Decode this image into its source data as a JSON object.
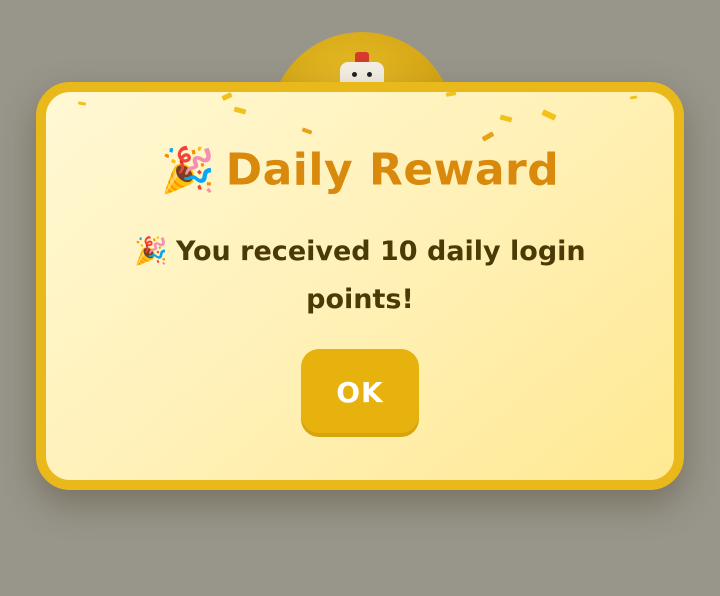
{
  "dialog": {
    "title_icon": "🎉",
    "title": "Daily Reward",
    "message_icon": "🎉",
    "message": "You received 10 daily login points!",
    "ok_label": "OK"
  },
  "background": {
    "mascot": "chicken-icon"
  },
  "colors": {
    "accent": "#e9b81a",
    "title": "#d9890c",
    "text": "#4a3a06",
    "button": "#e7b20e"
  }
}
